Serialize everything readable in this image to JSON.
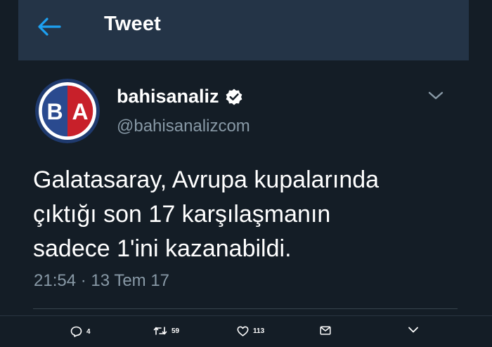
{
  "header": {
    "title": "Tweet",
    "back_icon": "arrow-left-icon"
  },
  "tweet": {
    "display_name": "bahisanaliz",
    "verified": true,
    "handle": "@bahisanalizcom",
    "text": "Galatasaray, Avrupa kupalarında\nçıktığı son 17 karşılaşmanın\nsadece 1'ini kazanabildi.",
    "timestamp": "21:54 · 13 Tem 17",
    "avatar_text": "BA"
  },
  "actions": {
    "replies": "4",
    "retweets": "59",
    "likes": "113"
  },
  "colors": {
    "background": "#141d26",
    "header": "#243447",
    "accent": "#1da1f2",
    "secondary_text": "#8899a6"
  }
}
